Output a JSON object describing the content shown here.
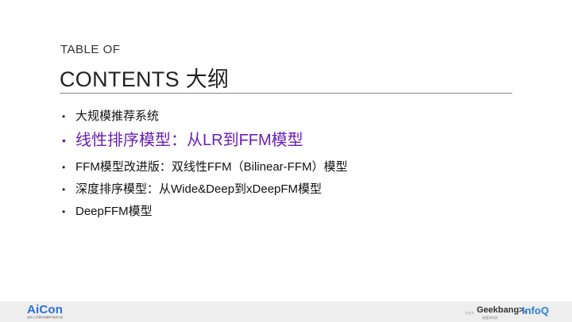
{
  "header": {
    "title_small": "TABLE OF",
    "title_big": "CONTENTS 大纲"
  },
  "agenda": {
    "bullet_glyph": "•",
    "items": [
      {
        "label": "大规模推荐系统",
        "active": false
      },
      {
        "label": "线性排序模型：从LR到FFM模型",
        "active": true
      },
      {
        "label": "FFM模型改进版：双线性FFM（Bilinear-FFM）模型",
        "active": false
      },
      {
        "label": "深度排序模型：从Wide&Deep到xDeepFM模型",
        "active": false
      },
      {
        "label": "DeepFFM模型",
        "active": false
      }
    ]
  },
  "footer": {
    "logo_left": "AiCon",
    "logo_left_sub": "全球人工智能与机器学习技术大会",
    "small_tag": "主办方",
    "logo_geek": "Geekbang>.",
    "logo_geek_sub": "极客邦科技",
    "logo_infoq": "InfoQ"
  },
  "colors": {
    "active_item": "#6a1fb8",
    "aicon": "#2a6fd6",
    "infoq": "#2d7fd1"
  }
}
